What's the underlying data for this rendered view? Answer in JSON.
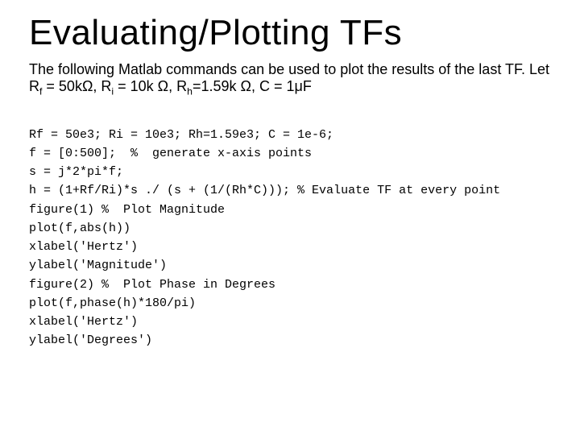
{
  "title": "Evaluating/Plotting TFs",
  "paragraph": {
    "pre": "The following Matlab commands can be used to plot the results of the last TF.  Let R",
    "sub1": "f",
    "p1": " = 50kΩ, R",
    "sub2": "i",
    "p2": " = 10k Ω, R",
    "sub3": "h",
    "p3": "=1.59k Ω, C = 1μF"
  },
  "code": {
    "l1": "Rf = 50e3; Ri = 10e3; Rh=1.59e3; C = 1e-6;",
    "l2": "f = [0:500];  %  generate x-axis points",
    "l3": "s = j*2*pi*f;",
    "l4": "h = (1+Rf/Ri)*s ./ (s + (1/(Rh*C))); % Evaluate TF at every point",
    "l5": "figure(1) %  Plot Magnitude",
    "l6": "plot(f,abs(h))",
    "l7": "xlabel('Hertz')",
    "l8": "ylabel('Magnitude')",
    "l9": "figure(2) %  Plot Phase in Degrees",
    "l10": "plot(f,phase(h)*180/pi)",
    "l11": "xlabel('Hertz')",
    "l12": "ylabel('Degrees')"
  }
}
